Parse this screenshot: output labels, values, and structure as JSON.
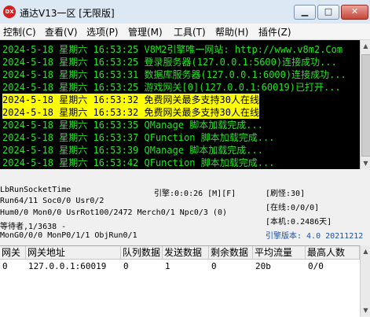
{
  "window": {
    "icon_label": "DX",
    "title": "通达V13一区 [无限版]",
    "min_symbol": "▁",
    "max_symbol": "□",
    "close_symbol": "✕"
  },
  "menu": [
    "控制(C)",
    "查看(V)",
    "选项(P)",
    "管理(M)",
    "工具(T)",
    "帮助(H)",
    "插件(Z)"
  ],
  "log": [
    {
      "text": "2024-5-18 星期六 16:53:25 V8M2引擎唯一网站: http://www.v8m2.Com",
      "highlight": false
    },
    {
      "text": "2024-5-18 星期六 16:53:25 登录服务器(127.0.0.1:5600)连接成功...",
      "highlight": false
    },
    {
      "text": "2024-5-18 星期六 16:53:31 数据库服务器(127.0.0.1:6000)连接成功...",
      "highlight": false
    },
    {
      "text": "2024-5-18 星期六 16:53:25 游戏网关[0](127.0.0.1:60019)已打开...",
      "highlight": false
    },
    {
      "text": "2024-5-18 星期六 16:53:32 免费网关最多支持30人在线",
      "highlight": true
    },
    {
      "text": "2024-5-18 星期六 16:53:32 免费网关最多支持30人在线",
      "highlight": true
    },
    {
      "text": "2024-5-18 星期六 16:53:35 QManage 脚本加载完成...",
      "highlight": false
    },
    {
      "text": "2024-5-18 星期六 16:53:37 QFunction 脚本加载完成...",
      "highlight": false
    },
    {
      "text": "2024-5-18 星期六 16:53:39 QManage 脚本加载完成...",
      "highlight": false
    },
    {
      "text": "2024-5-18 星期六 16:53:42 QFunction 脚本加载完成...",
      "highlight": false
    }
  ],
  "status": {
    "run_socket_time": "LbRunSocketTime",
    "run_info": "Run64/11 Soc0/0 Usr0/2",
    "hum_info": "Hum0/0 Mon0/0 UsrRot100/2472 Merch0/1 Npc0/3 (0)",
    "waiting": "等待者,1/3638 -",
    "mon_info": "MonG0/0/0 MonP0/1/1 ObjRun0/1",
    "engine_time": "引擎:0:0:26 [M][F]",
    "refresh": "[刷怪:30]",
    "online": "[在线:0/0/0]",
    "local": "[本机:0.2486天]",
    "engine_version": "引擎版本: 4.0 20211212"
  },
  "grid": {
    "headers": [
      "网关",
      "网关地址",
      "队列数据",
      "发送数据",
      "剩余数据",
      "平均流量",
      "最高人数"
    ],
    "rows": [
      [
        "0",
        "127.0.0.1:60019",
        "0",
        "1",
        "0",
        "20b",
        "0/0"
      ]
    ]
  },
  "colors": {
    "console_bg": "#000000",
    "console_text": "#21e421",
    "highlight_bg": "#ffff00",
    "version_text": "#1b4fa8"
  }
}
